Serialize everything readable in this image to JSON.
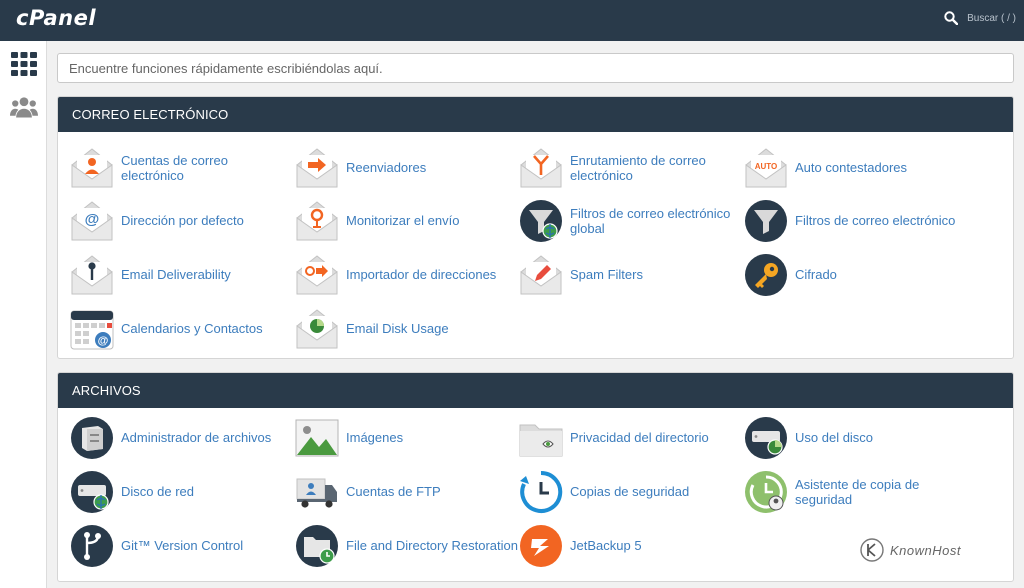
{
  "header": {
    "logo": "cPanel",
    "search_label": "Buscar ( / )"
  },
  "quick_search": {
    "placeholder": "Encuentre funciones rápidamente escribiéndolas aquí."
  },
  "sections": {
    "email": {
      "title": "CORREO ELECTRÓNICO",
      "items": [
        {
          "label": "Cuentas de correo electrónico"
        },
        {
          "label": "Reenviadores"
        },
        {
          "label": "Enrutamiento de correo electrónico"
        },
        {
          "label": "Auto contestadores"
        },
        {
          "label": "Dirección por defecto"
        },
        {
          "label": "Monitorizar el envío"
        },
        {
          "label": "Filtros de correo electrónico global"
        },
        {
          "label": "Filtros de correo electrónico"
        },
        {
          "label": "Email Deliverability"
        },
        {
          "label": "Importador de direcciones"
        },
        {
          "label": "Spam Filters"
        },
        {
          "label": "Cifrado"
        },
        {
          "label": "Calendarios y Contactos"
        },
        {
          "label": "Email Disk Usage"
        }
      ]
    },
    "files": {
      "title": "ARCHIVOS",
      "items": [
        {
          "label": "Administrador de archivos"
        },
        {
          "label": "Imágenes"
        },
        {
          "label": "Privacidad del directorio"
        },
        {
          "label": "Uso del disco"
        },
        {
          "label": "Disco de red"
        },
        {
          "label": "Cuentas de FTP"
        },
        {
          "label": "Copias de seguridad"
        },
        {
          "label": "Asistente de copia de seguridad"
        },
        {
          "label": "Git™ Version Control"
        },
        {
          "label": "File and Directory Restoration"
        },
        {
          "label": "JetBackup 5"
        }
      ]
    }
  },
  "icon_text": {
    "auto": "AUTO",
    "at": "@"
  },
  "watermark": "KnownHost",
  "colors": {
    "header_bg": "#293a4a",
    "link": "#3d7dbd",
    "accent_orange": "#f26522",
    "navy": "#293a4a"
  }
}
